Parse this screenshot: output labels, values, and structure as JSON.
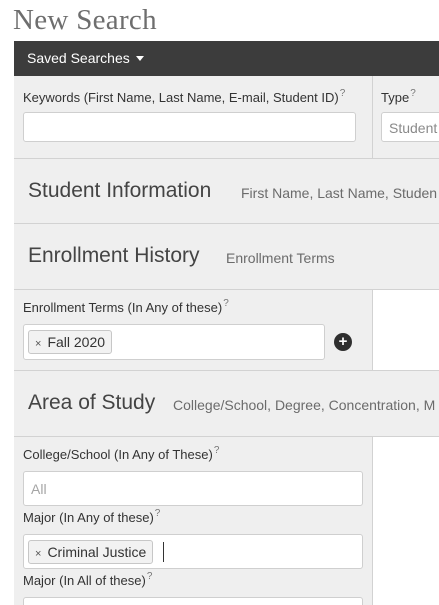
{
  "page_title": "New Search",
  "saved_searches": {
    "label": "Saved Searches"
  },
  "keywords": {
    "label": "Keywords (First Name, Last Name, E-mail, Student ID)",
    "help": "?",
    "value": ""
  },
  "type": {
    "label": "Type",
    "help": "?",
    "value": "Student"
  },
  "sections": {
    "student_information": {
      "title": "Student Information",
      "subtitle": "First Name, Last Name, Studen"
    },
    "enrollment_history": {
      "title": "Enrollment History",
      "subtitle": "Enrollment Terms"
    },
    "area_of_study": {
      "title": "Area of Study",
      "subtitle": "College/School, Degree, Concentration, M"
    }
  },
  "enrollment_terms": {
    "label": "Enrollment Terms (In Any of these)",
    "help": "?",
    "tags": [
      "Fall 2020"
    ],
    "remove_glyph": "×",
    "add_icon": "plus-circle-icon",
    "add_glyph": "+"
  },
  "college_school": {
    "label": "College/School (In Any of These)",
    "help": "?",
    "placeholder": "All"
  },
  "major_any": {
    "label": "Major (In Any of these)",
    "help": "?",
    "tags": [
      "Criminal Justice"
    ],
    "remove_glyph": "×"
  },
  "major_all": {
    "label": "Major (In All of these)",
    "help": "?"
  }
}
